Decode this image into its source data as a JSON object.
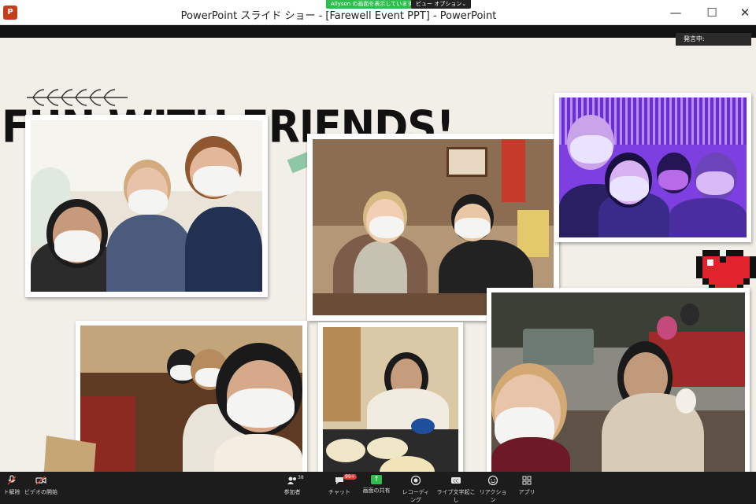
{
  "window": {
    "title": "PowerPoint スライド ショー - [Farewell Event PPT] - PowerPoint",
    "app_icon": "P",
    "share_badge": "Allyson の画面を表示しています",
    "view_options": "ビュー オプション⌄",
    "buttons": {
      "minimize": "—",
      "maximize": "☐",
      "close": "✕"
    }
  },
  "speaking_indicator": "発言中:",
  "slide": {
    "title": "FUN  WITH FRIENDS!",
    "heart_icon": "pixel-heart",
    "leaves_icon": "leaf-garland"
  },
  "toolbar": {
    "items": [
      {
        "label": "ト解除",
        "icon": "mic-muted-icon"
      },
      {
        "label": "ビデオの開始",
        "icon": "video-off-icon"
      },
      {
        "label": "参加者",
        "icon": "participants-icon",
        "count": "38"
      },
      {
        "label": "チャット",
        "icon": "chat-icon",
        "badge": "99+"
      },
      {
        "label": "画面の共有",
        "icon": "share-screen-icon"
      },
      {
        "label": "レコーディング",
        "icon": "record-icon"
      },
      {
        "label": "ライブ文字起こし",
        "icon": "cc-icon"
      },
      {
        "label": "リアクション",
        "icon": "reaction-icon"
      },
      {
        "label": "アプリ",
        "icon": "apps-icon"
      }
    ]
  },
  "colors": {
    "slide_bg": "#f1efe8",
    "tape": "#7dbf98",
    "kraft": "#c7a676",
    "heart": "#e0232c",
    "share_green": "#2dbe4e",
    "chat_badge": "#e23b3b"
  }
}
